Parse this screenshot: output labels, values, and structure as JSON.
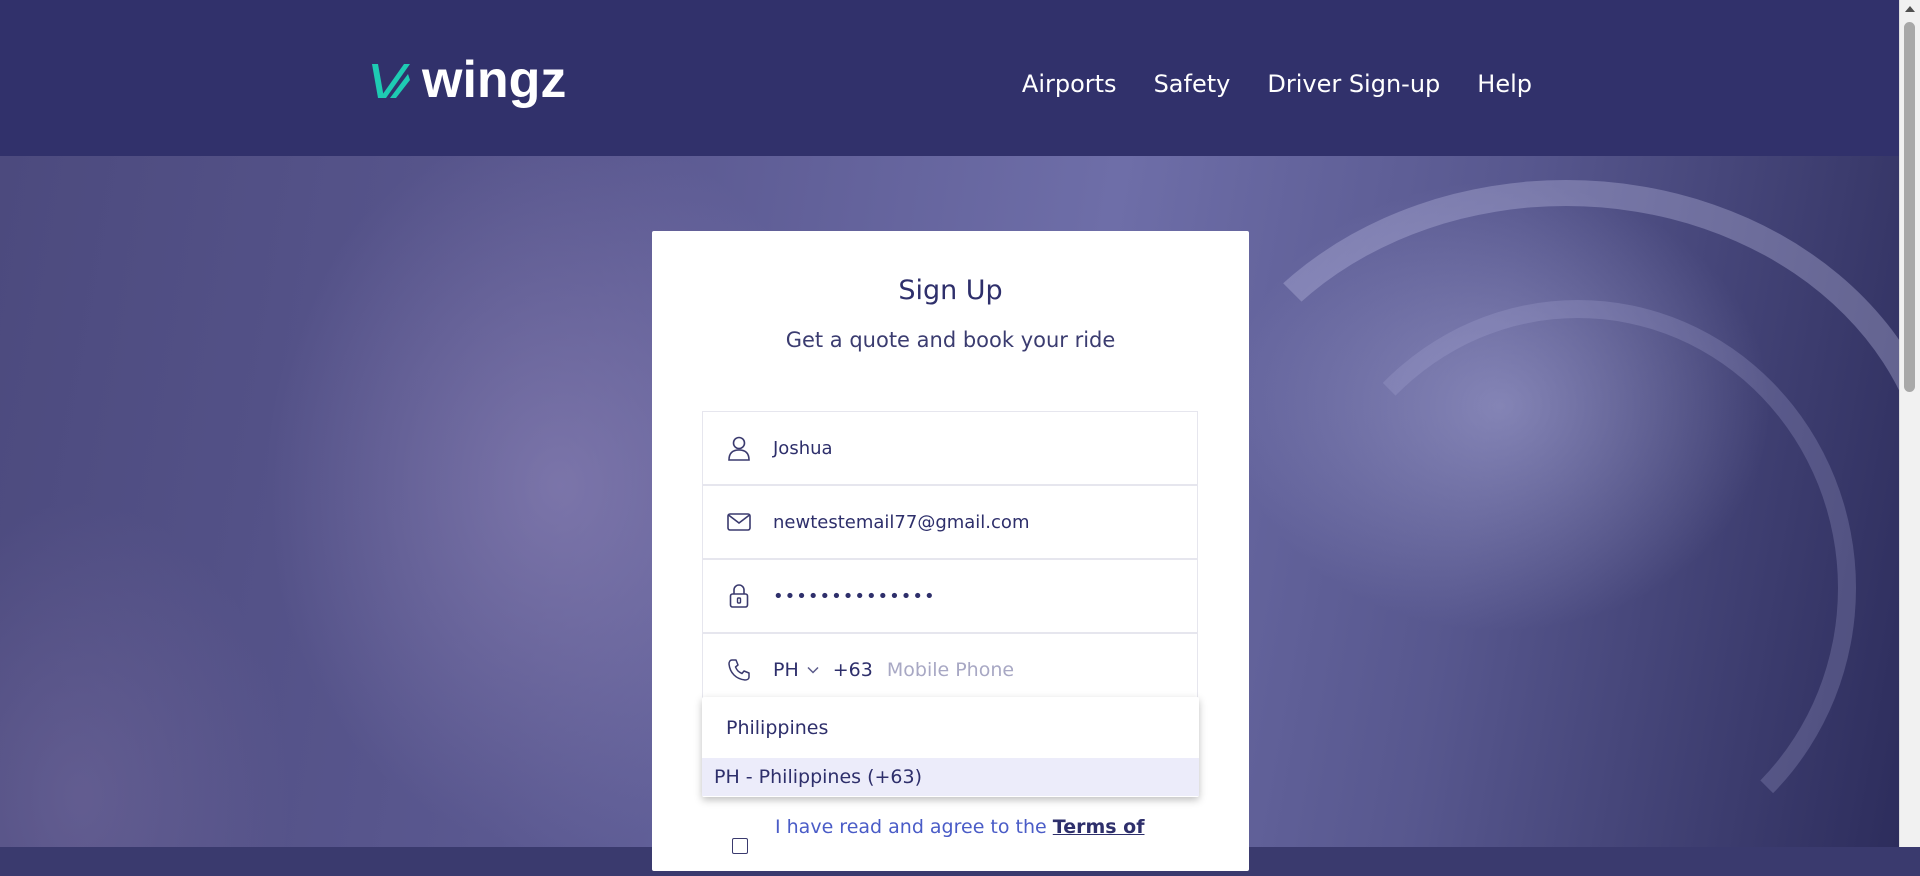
{
  "header": {
    "logo_text": "wingz",
    "nav": [
      "Airports",
      "Safety",
      "Driver Sign-up",
      "Help"
    ]
  },
  "form": {
    "title": "Sign Up",
    "subtitle": "Get a quote and book your ride",
    "name_value": "Joshua",
    "email_value": "newtestemail77@gmail.com",
    "password_masked": "••••••••••••••",
    "country_code": "PH",
    "dial_code": "+63",
    "phone_placeholder": "Mobile Phone",
    "terms_prefix": "I have read and agree to the ",
    "terms_link": "Terms of"
  },
  "dropdown": {
    "group_label": "Philippines",
    "option": "PH - Philippines (+63)"
  },
  "icons": {
    "name": "user-icon",
    "email": "envelope-icon",
    "password": "lock-icon",
    "phone": "phone-icon"
  },
  "colors": {
    "header_bg": "#31316b",
    "brand_accent": "#1ecbb3",
    "text_primary": "#2e2f6b"
  }
}
